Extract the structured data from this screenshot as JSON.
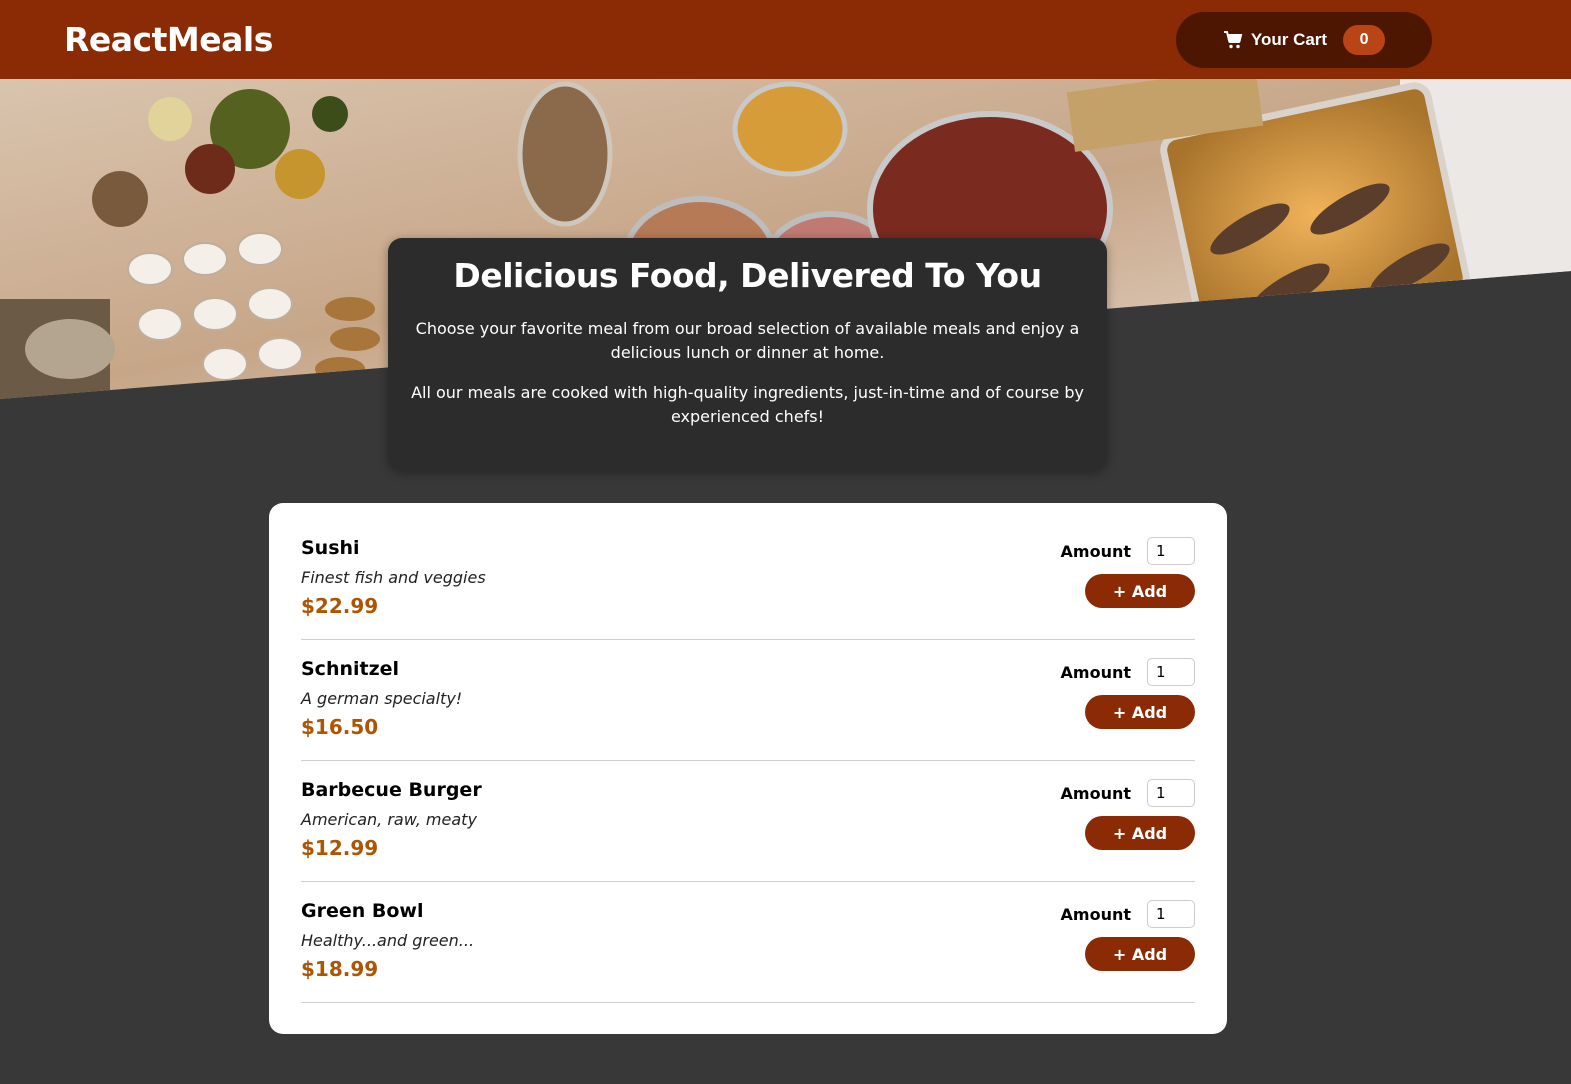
{
  "header": {
    "brand": "ReactMeals",
    "cart_label": "Your Cart",
    "cart_count": "0"
  },
  "hero": {
    "image": "meals-buffet-image"
  },
  "summary": {
    "title": "Delicious Food, Delivered To You",
    "paragraph1": "Choose your favorite meal from our broad selection of available meals and enjoy a delicious lunch or dinner at home.",
    "paragraph2": "All our meals are cooked with high-quality ingredients, just-in-time and of course by experienced chefs!"
  },
  "meals": [
    {
      "name": "Sushi",
      "description": "Finest fish and veggies",
      "price": "$22.99",
      "amount_label": "Amount",
      "amount": "1",
      "add_label": "+ Add"
    },
    {
      "name": "Schnitzel",
      "description": "A german specialty!",
      "price": "$16.50",
      "amount_label": "Amount",
      "amount": "1",
      "add_label": "+ Add"
    },
    {
      "name": "Barbecue Burger",
      "description": "American, raw, meaty",
      "price": "$12.99",
      "amount_label": "Amount",
      "amount": "1",
      "add_label": "+ Add"
    },
    {
      "name": "Green Bowl",
      "description": "Healthy...and green...",
      "price": "$18.99",
      "amount_label": "Amount",
      "amount": "1",
      "add_label": "+ Add"
    }
  ],
  "colors": {
    "header_bg": "#8a2b06",
    "cart_bg": "#4d1601",
    "badge_bg": "#b94517",
    "page_bg": "#383838",
    "price": "#ad5502"
  },
  "icons": {
    "cart": "shopping-cart-icon"
  }
}
